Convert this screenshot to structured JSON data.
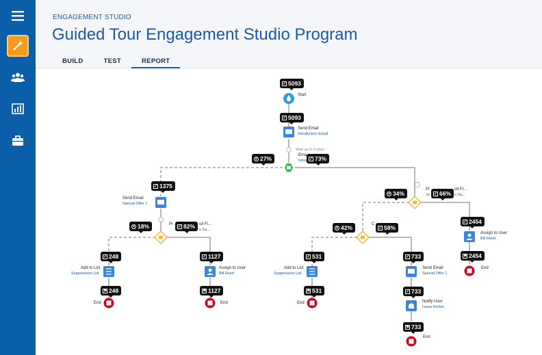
{
  "sidebar": {
    "items": [
      {
        "icon": "menu-icon"
      },
      {
        "icon": "magic-wand-icon",
        "active": true
      },
      {
        "icon": "people-icon"
      },
      {
        "icon": "bar-chart-icon"
      },
      {
        "icon": "briefcase-icon"
      }
    ]
  },
  "header": {
    "breadcrumb": "ENGAGEMENT STUDIO",
    "title": "Guided Tour Engagement Studio Program",
    "tabs": [
      {
        "label": "BUILD",
        "active": false
      },
      {
        "label": "TEST",
        "active": false
      },
      {
        "label": "REPORT",
        "active": true
      }
    ]
  },
  "flow": {
    "start": {
      "count": "5093",
      "label": "Start"
    },
    "send_email_1": {
      "count": "5093",
      "label": "Send Email",
      "sub": "Introduction Email"
    },
    "wait_1": {
      "label": "Wait up to 4 days"
    },
    "rule_1": {
      "label_prefix": "Ema",
      "sub_prefix": "Introd",
      "no_pct": "27%",
      "yes_pct": "73%"
    },
    "left": {
      "send_email": {
        "count": "1375",
        "label": "Send Email",
        "sub": "Special Offer 1"
      },
      "rule": {
        "label_prefix": "Pr",
        "label_suffix": "ult Fi...",
        "sub_suffix": "s Sa...",
        "no_pct": "18%",
        "yes_pct": "82%"
      },
      "add_list": {
        "count": "248",
        "label": "Add to List",
        "sub": "Suppression List",
        "end_count": "248",
        "end": "End"
      },
      "assign": {
        "count": "1127",
        "label": "Assign to User",
        "sub": "Bill Reed",
        "end_count": "1127",
        "end": "End"
      }
    },
    "right": {
      "rule": {
        "label_prefix": "Pr",
        "label_suffix": "ult Fi...",
        "sub_prefix": "Jo",
        "sub_suffix": "s Sa...",
        "no_pct": "34%",
        "yes_pct": "66%"
      },
      "inner_rule": {
        "label_prefix": "C",
        "no_pct": "42%",
        "yes_pct": "58%"
      },
      "add_list": {
        "count": "531",
        "label": "Add to List",
        "sub": "Suppression List",
        "end_count": "531",
        "end": "End"
      },
      "send_email": {
        "count": "733",
        "label": "Send Email",
        "sub": "Special Offer 1"
      },
      "notify": {
        "count": "733",
        "label": "Notify User",
        "sub": "Laura Horton"
      },
      "notify_end": {
        "count": "733",
        "end": "End"
      },
      "assign": {
        "count": "2454",
        "label": "Assign to User",
        "sub": "Bill Reed",
        "end_count": "2454",
        "end": "End"
      }
    }
  },
  "colors": {
    "sidebar": "#0a5fa8",
    "accent": "#f59b1e",
    "node_blue": "#3b86d8",
    "start": "#2e9ed7",
    "end_red": "#d0021b",
    "rule_green": "#2db84b",
    "link": "#1b5aa6"
  }
}
